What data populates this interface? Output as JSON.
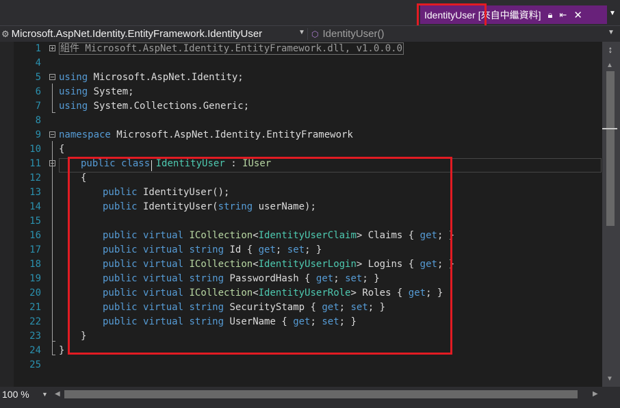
{
  "tab": {
    "title": "IdentityUser",
    "subtitle": "[來自中繼資料]",
    "icons": [
      "lock-icon",
      "pin-icon",
      "close-icon"
    ]
  },
  "nav": {
    "left_label": "Microsoft.AspNet.Identity.EntityFramework.IdentityUser",
    "right_label": "IdentityUser()"
  },
  "colors": {
    "keyword": "#569cd6",
    "type": "#4ec9b0",
    "interface": "#b8d7a3",
    "line_number": "#2b91af",
    "highlight_box": "#e21b23",
    "tab_active": "#68217a"
  },
  "lines": [
    {
      "num": "1"
    },
    {
      "num": "4"
    },
    {
      "num": "5"
    },
    {
      "num": "6"
    },
    {
      "num": "7"
    },
    {
      "num": "8"
    },
    {
      "num": "9"
    },
    {
      "num": "10"
    },
    {
      "num": "11"
    },
    {
      "num": "12"
    },
    {
      "num": "13"
    },
    {
      "num": "14"
    },
    {
      "num": "15"
    },
    {
      "num": "16"
    },
    {
      "num": "17"
    },
    {
      "num": "18"
    },
    {
      "num": "19"
    },
    {
      "num": "20"
    },
    {
      "num": "21"
    },
    {
      "num": "22"
    },
    {
      "num": "23"
    },
    {
      "num": "24"
    },
    {
      "num": "25"
    }
  ],
  "code": {
    "l1": "組件 Microsoft.AspNet.Identity.EntityFramework.dll, v1.0.0.0",
    "using": "using",
    "ns1": " Microsoft.AspNet.Identity;",
    "ns2": " System;",
    "ns3": " System.Collections.Generic;",
    "namespace": "namespace",
    "ns_name": " Microsoft.AspNet.Identity.EntityFramework",
    "open_brace": "{",
    "close_brace": "}",
    "public": "public",
    "class": "class",
    "virtual": "virtual",
    "string": "string",
    "class_name": "IdentityUser",
    "colon": " : ",
    "iuser": "IUser",
    "ctor1": " IdentityUser();",
    "ctor2": " IdentityUser(",
    "ctor2_end": " userName);",
    "icollection": "ICollection",
    "lt": "<",
    "gt": ">",
    "claim": "IdentityUserClaim",
    "login": "IdentityUserLogin",
    "role": "IdentityUserRole",
    "claims_pre": " Claims { ",
    "id_pre": " Id { ",
    "logins_pre": " Logins { ",
    "pwd_pre": " PasswordHash { ",
    "roles_pre": " Roles { ",
    "stamp_pre": " SecurityStamp { ",
    "uname_pre": " UserName { ",
    "get": "get",
    "set": "set",
    "semi": "; ",
    "semi_close": "; }"
  },
  "zoom": "100 %"
}
